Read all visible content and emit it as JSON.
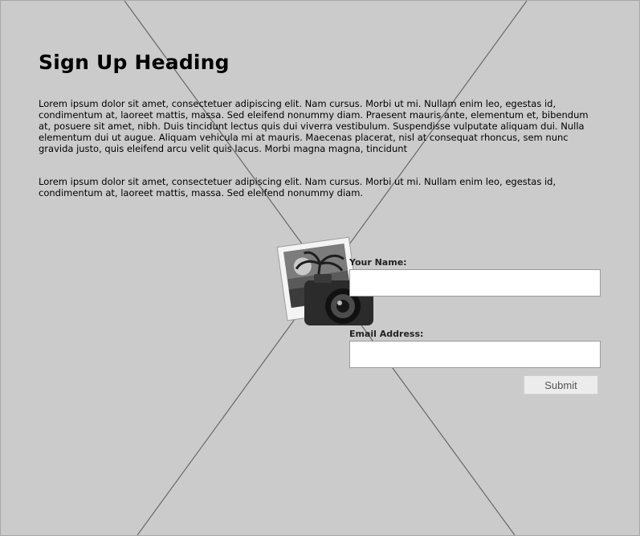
{
  "page": {
    "heading": "Sign Up Heading",
    "paragraphs": [
      "Lorem ipsum dolor sit amet, consectetuer adipiscing elit. Nam cursus. Morbi ut mi. Nullam enim leo, egestas id, condimentum at, laoreet mattis, massa. Sed eleifend nonummy diam. Praesent mauris ante, elementum et, bibendum at, posuere sit amet, nibh. Duis tincidunt lectus quis dui viverra vestibulum. Suspendisse vulputate aliquam dui. Nulla elementum dui ut augue. Aliquam vehicula mi at mauris. Maecenas placerat, nisl at consequat rhoncus, sem nunc gravida justo, quis eleifend arcu velit quis lacus. Morbi magna magna, tincidunt",
      "Lorem ipsum dolor sit amet, consectetuer adipiscing elit. Nam cursus. Morbi ut mi. Nullam enim leo, egestas id, condimentum at, laoreet mattis, massa. Sed eleifend nonummy diam."
    ]
  },
  "form": {
    "name_label": "Your Name:",
    "name_value": "",
    "email_label": "Email Address:",
    "email_value": "",
    "submit_label": "Submit"
  },
  "icons": {
    "placeholder": "image-placeholder-icon",
    "photo": "photo-camera-icon"
  },
  "colors": {
    "background": "#cbcbcb",
    "field_background": "#ffffff",
    "button_background": "#ececec"
  }
}
